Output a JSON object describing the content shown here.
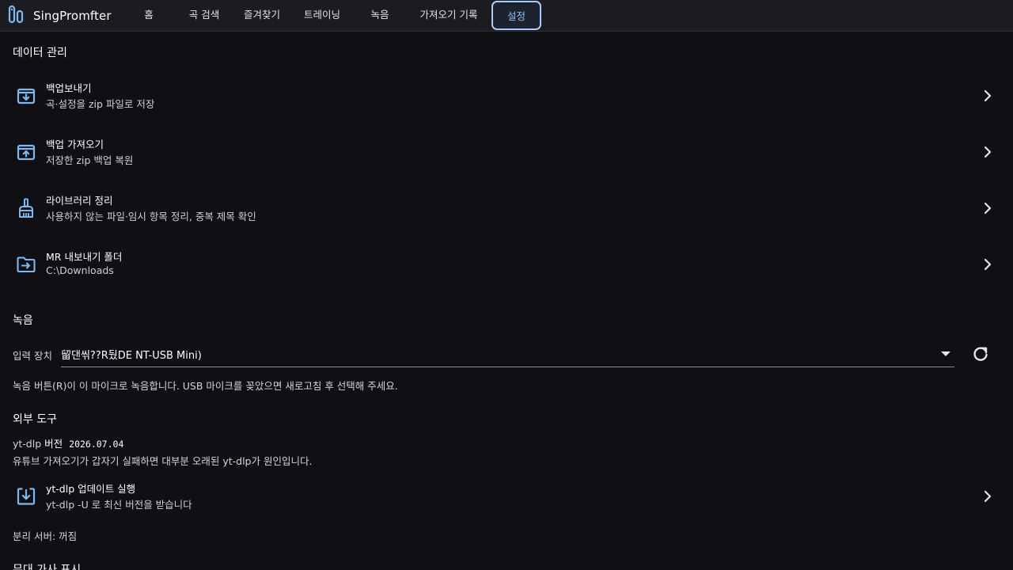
{
  "app": {
    "name": "SingPromfter"
  },
  "nav": {
    "tabs": [
      {
        "label": "홈"
      },
      {
        "label": "곡 검색"
      },
      {
        "label": "즐겨찾기"
      },
      {
        "label": "트레이닝"
      },
      {
        "label": "녹음"
      },
      {
        "label": "가져오기 기록"
      },
      {
        "label": "설정"
      }
    ],
    "active_tab": "설정"
  },
  "data_management": {
    "title": "데이터 관리",
    "items": [
      {
        "title": "백업보내기",
        "subtitle": "곡·설정을 zip 파일로 저장",
        "icon": "archive-download-icon"
      },
      {
        "title": "백업 가져오기",
        "subtitle": "저장한 zip 백업 복원",
        "icon": "archive-upload-icon"
      },
      {
        "title": "라이브러리 정리",
        "subtitle": "사용하지 않는 파일·임시 항목 정리, 중복 제목 확인",
        "icon": "broom-icon"
      },
      {
        "title": "MR 내보내기 폴더",
        "subtitle": "C:\\Downloads",
        "icon": "folder-export-icon"
      }
    ]
  },
  "recording": {
    "title": "녹음",
    "input_label": "입력 장치",
    "input_device": "留댄씪??R뒀DE NT-USB Mini)",
    "hint": "녹음 버튼(R)이 이 마이크로 녹음합니다. USB 마이크를 꽂았으면 새로고침 후 선택해 주세요."
  },
  "external_tools": {
    "title": "외부 도구",
    "ytdlp_prefix": "yt-dlp",
    "ytdlp_label": "버전",
    "ytdlp_version": "2026.07.04",
    "ytdlp_hint": "유튜브 가져오기가 갑자기 실패하면 대부분 오래된 yt-dlp가 원인입니다.",
    "update_item": {
      "title": "yt-dlp 업데이트 실행",
      "subtitle": "yt-dlp -U 로 최신 버전을 받습니다",
      "icon": "download-icon"
    },
    "separation_server": "분리 서버: 꺼짐"
  },
  "next_section": {
    "title": "무대 가사 표시"
  },
  "colors": {
    "background": "#0f0f14",
    "topbar": "#1b1c22",
    "accent": "#8ec2f5",
    "icon": "#7fb8ef"
  }
}
